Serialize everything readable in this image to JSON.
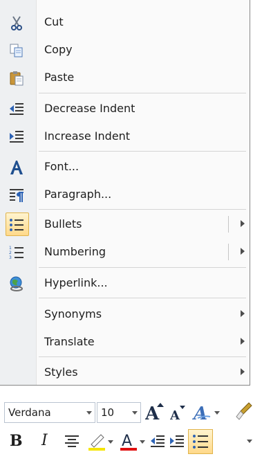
{
  "context_menu": {
    "items": [
      {
        "label": "Cut",
        "icon": "scissors-icon"
      },
      {
        "label": "Copy",
        "icon": "copy-icon"
      },
      {
        "label": "Paste",
        "icon": "paste-icon"
      },
      {
        "label": "Decrease Indent",
        "icon": "decrease-indent-icon"
      },
      {
        "label": "Increase Indent",
        "icon": "increase-indent-icon"
      },
      {
        "label": "Font...",
        "icon": "font-icon"
      },
      {
        "label": "Paragraph...",
        "icon": "paragraph-icon"
      },
      {
        "label": "Bullets",
        "icon": "bullets-icon",
        "submenu": true,
        "active": true
      },
      {
        "label": "Numbering",
        "icon": "numbering-icon",
        "submenu": true
      },
      {
        "label": "Hyperlink...",
        "icon": "hyperlink-globe-icon"
      },
      {
        "label": "Synonyms",
        "submenu": true
      },
      {
        "label": "Translate",
        "submenu": true
      },
      {
        "label": "Styles",
        "submenu": true
      }
    ]
  },
  "mini_toolbar": {
    "font_name": "Verdana",
    "font_size": "10",
    "grow_font_glyph": "A",
    "shrink_font_glyph": "A",
    "bold_glyph": "B",
    "italic_glyph": "I",
    "font_color_glyph": "A",
    "styles_glyph": "A",
    "colors": {
      "font_color": "#e01010",
      "highlight": "#f5e500",
      "accent": "#1f4f8f"
    }
  }
}
